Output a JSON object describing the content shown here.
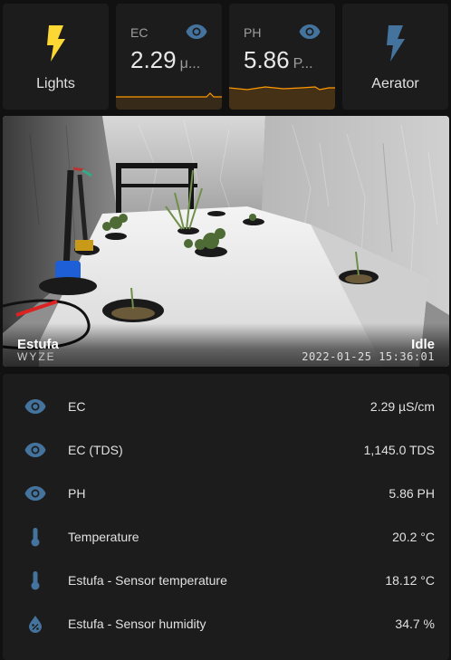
{
  "tiles": {
    "lights": {
      "label": "Lights",
      "icon": "lightning-bolt-icon",
      "color": "#fdd835"
    },
    "ec": {
      "name": "EC",
      "value": "2.29",
      "unit": "μ...",
      "icon": "eye-icon",
      "spark_color": "#ff9800"
    },
    "ph": {
      "name": "PH",
      "value": "5.86",
      "unit": "P...",
      "icon": "eye-icon",
      "spark_color": "#ff9800"
    },
    "aerator": {
      "label": "Aerator",
      "icon": "lightning-bolt-icon",
      "color": "#44739e"
    }
  },
  "camera": {
    "name": "Estufa",
    "state": "Idle",
    "timestamp": "2022-01-25  15:36:01",
    "brand": "WYZE"
  },
  "entities": [
    {
      "name": "EC",
      "value": "2.29 µS/cm",
      "icon": "eye-icon"
    },
    {
      "name": "EC (TDS)",
      "value": "1,145.0 TDS",
      "icon": "eye-icon"
    },
    {
      "name": "PH",
      "value": "5.86 PH",
      "icon": "eye-icon"
    },
    {
      "name": "Temperature",
      "value": "20.2 °C",
      "icon": "thermometer-icon"
    },
    {
      "name": "Estufa - Sensor temperature",
      "value": "18.12 °C",
      "icon": "thermometer-icon"
    },
    {
      "name": "Estufa - Sensor humidity",
      "value": "34.7 %",
      "icon": "water-percent-icon"
    }
  ],
  "colors": {
    "icon_blue": "#44739e",
    "background": "#111111",
    "card": "#1c1c1c"
  }
}
